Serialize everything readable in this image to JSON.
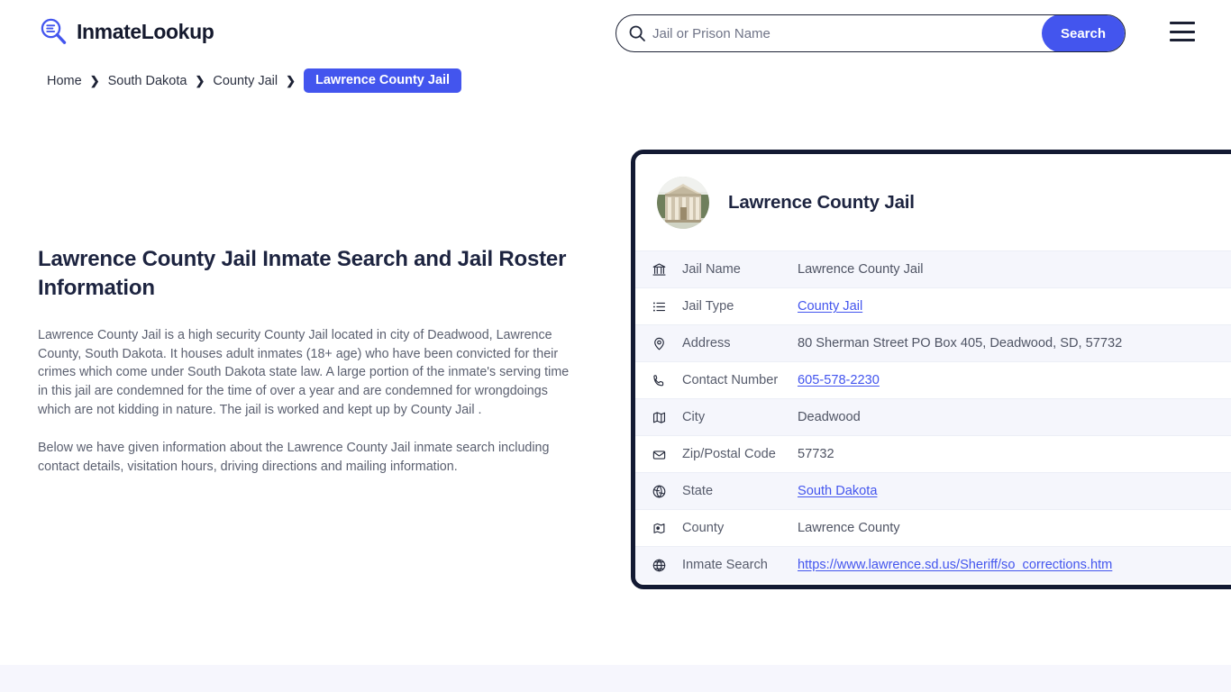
{
  "header": {
    "brand_name": "InmateLookup",
    "brand_icon": "search-list-logo-icon",
    "search": {
      "placeholder": "Jail or Prison Name",
      "value": "",
      "icon": "search-icon",
      "button_label": "Search"
    },
    "menu_icon": "hamburger-menu-icon"
  },
  "breadcrumb": {
    "items": [
      {
        "label": "Home",
        "current": false
      },
      {
        "label": "South Dakota",
        "current": false
      },
      {
        "label": "County Jail",
        "current": false
      },
      {
        "label": "Lawrence County Jail",
        "current": true
      }
    ],
    "separator": "❯"
  },
  "main": {
    "title": "Lawrence County Jail Inmate Search and Jail Roster Information",
    "paragraph_1": "Lawrence County Jail is a high security County Jail located in city of Deadwood, Lawrence County, South Dakota. It houses adult inmates (18+ age) who have been convicted for their crimes which come under South Dakota state law. A large portion of the inmate's serving time in this jail are condemned for the time of over a year and are condemned for wrongdoings which are not kidding in nature. The jail is worked and kept up by County Jail .",
    "paragraph_2": "Below we have given information about the Lawrence County Jail inmate search including contact details, visitation hours, driving directions and mailing information."
  },
  "card": {
    "avatar_icon": "courthouse-building-photo",
    "title": "Lawrence County Jail",
    "rows": [
      {
        "icon": "bank-building-icon",
        "label": "Jail Name",
        "value": "Lawrence County Jail",
        "is_link": false
      },
      {
        "icon": "list-icon",
        "label": "Jail Type",
        "value": "County Jail",
        "is_link": true
      },
      {
        "icon": "map-pin-icon",
        "label": "Address",
        "value": "80 Sherman Street PO Box 405, Deadwood, SD, 57732",
        "is_link": false
      },
      {
        "icon": "phone-icon",
        "label": "Contact Number",
        "value": "605-578-2230",
        "is_link": true
      },
      {
        "icon": "folded-map-icon",
        "label": "City",
        "value": "Deadwood",
        "is_link": false
      },
      {
        "icon": "envelope-icon",
        "label": "Zip/Postal Code",
        "value": "57732",
        "is_link": false
      },
      {
        "icon": "globe-icon",
        "label": "State",
        "value": "South Dakota",
        "is_link": true
      },
      {
        "icon": "map-location-icon",
        "label": "County",
        "value": "Lawrence County",
        "is_link": false
      },
      {
        "icon": "globe-grid-icon",
        "label": "Inmate Search",
        "value": "https://www.lawrence.sd.us/Sheriff/so_corrections.htm",
        "is_link": true
      }
    ]
  },
  "colors": {
    "accent_blue": "#4355ee",
    "card_border": "#131a33",
    "row_stripe": "#f5f6fc",
    "heading": "#1d2440",
    "body_text": "#5b6070",
    "footer_band": "#f6f6fd"
  }
}
